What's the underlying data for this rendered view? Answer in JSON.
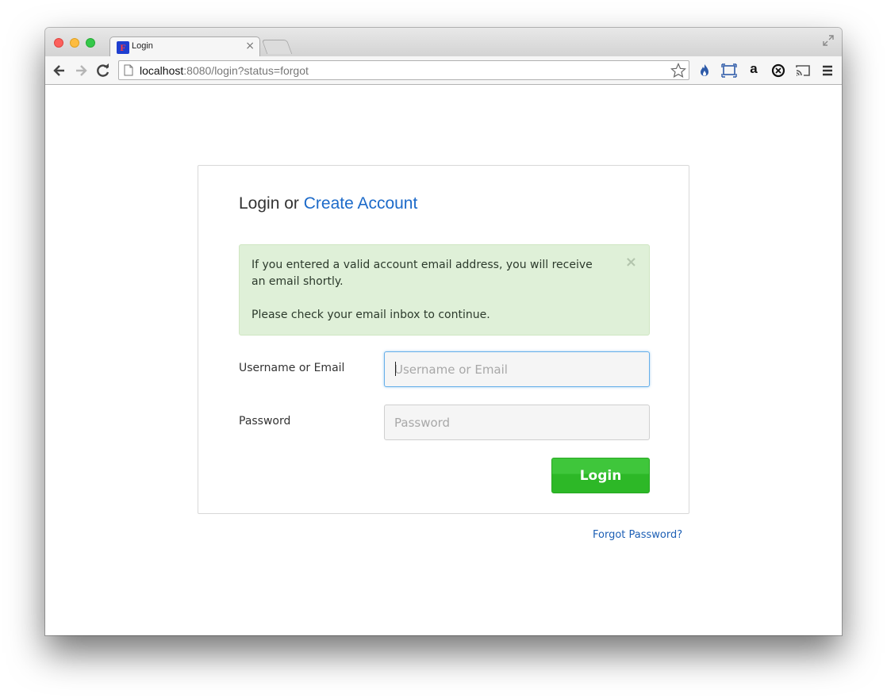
{
  "browser": {
    "tab_title": "Login",
    "tab_close": "×",
    "favicon_glyph": "F",
    "url_host": "localhost",
    "url_rest": ":8080/login?status=forgot",
    "extensions": [
      "flame-icon",
      "screen-capture-icon",
      "amazon-icon",
      "sync-icon",
      "cast-icon",
      "menu-icon"
    ],
    "amazon_glyph": "a"
  },
  "login": {
    "heading_prefix": "Login or ",
    "create_account_link": "Create Account",
    "alert": {
      "line1": "If you entered a valid account email address, you will receive an email shortly.",
      "line2": "Please check your email inbox to continue.",
      "close": "×",
      "color": "#dff0d8"
    },
    "username_label": "Username or Email",
    "username_placeholder": "Username or Email",
    "username_value": "",
    "password_label": "Password",
    "password_placeholder": "Password",
    "password_value": "",
    "login_button": "Login",
    "login_button_color": "#33bd2e",
    "forgot_password_link": "Forgot Password?",
    "link_color": "#1c6ac9"
  }
}
